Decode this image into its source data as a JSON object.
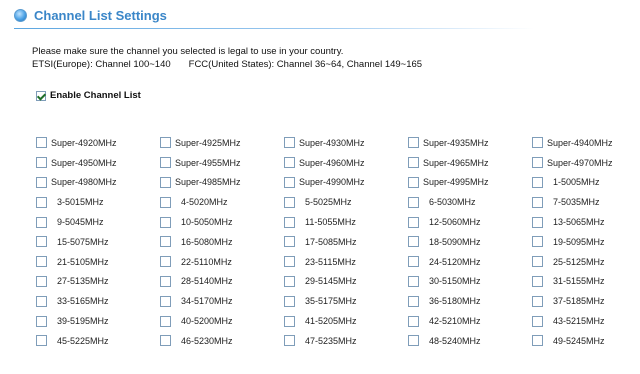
{
  "section": {
    "title": "Channel List Settings"
  },
  "notice": {
    "line1": "Please make sure the channel you selected is legal to use in your country.",
    "etsi": "ETSI(Europe): Channel 100~140",
    "fcc": "FCC(United States): Channel 36~64, Channel 149~165"
  },
  "enable_channel_list": {
    "label": "Enable Channel List",
    "checked": true
  },
  "channels": [
    {
      "label": "Super-4920MHz",
      "checked": false
    },
    {
      "label": "Super-4925MHz",
      "checked": false
    },
    {
      "label": "Super-4930MHz",
      "checked": false
    },
    {
      "label": "Super-4935MHz",
      "checked": false
    },
    {
      "label": "Super-4940MHz",
      "checked": false
    },
    {
      "label": "Super-4950MHz",
      "checked": false
    },
    {
      "label": "Super-4955MHz",
      "checked": false
    },
    {
      "label": "Super-4960MHz",
      "checked": false
    },
    {
      "label": "Super-4965MHz",
      "checked": false
    },
    {
      "label": "Super-4970MHz",
      "checked": false
    },
    {
      "label": "Super-4980MHz",
      "checked": false
    },
    {
      "label": "Super-4985MHz",
      "checked": false
    },
    {
      "label": "Super-4990MHz",
      "checked": false
    },
    {
      "label": "Super-4995MHz",
      "checked": false
    },
    {
      "label": "1-5005MHz",
      "checked": false
    },
    {
      "label": "3-5015MHz",
      "checked": false
    },
    {
      "label": "4-5020MHz",
      "checked": false
    },
    {
      "label": "5-5025MHz",
      "checked": false
    },
    {
      "label": "6-5030MHz",
      "checked": false
    },
    {
      "label": "7-5035MHz",
      "checked": false
    },
    {
      "label": "9-5045MHz",
      "checked": false
    },
    {
      "label": "10-5050MHz",
      "checked": false
    },
    {
      "label": "11-5055MHz",
      "checked": false
    },
    {
      "label": "12-5060MHz",
      "checked": false
    },
    {
      "label": "13-5065MHz",
      "checked": false
    },
    {
      "label": "15-5075MHz",
      "checked": false
    },
    {
      "label": "16-5080MHz",
      "checked": false
    },
    {
      "label": "17-5085MHz",
      "checked": false
    },
    {
      "label": "18-5090MHz",
      "checked": false
    },
    {
      "label": "19-5095MHz",
      "checked": false
    },
    {
      "label": "21-5105MHz",
      "checked": false
    },
    {
      "label": "22-5110MHz",
      "checked": false
    },
    {
      "label": "23-5115MHz",
      "checked": false
    },
    {
      "label": "24-5120MHz",
      "checked": false
    },
    {
      "label": "25-5125MHz",
      "checked": false
    },
    {
      "label": "27-5135MHz",
      "checked": false
    },
    {
      "label": "28-5140MHz",
      "checked": false
    },
    {
      "label": "29-5145MHz",
      "checked": false
    },
    {
      "label": "30-5150MHz",
      "checked": false
    },
    {
      "label": "31-5155MHz",
      "checked": false
    },
    {
      "label": "33-5165MHz",
      "checked": false
    },
    {
      "label": "34-5170MHz",
      "checked": false
    },
    {
      "label": "35-5175MHz",
      "checked": false
    },
    {
      "label": "36-5180MHz",
      "checked": false
    },
    {
      "label": "37-5185MHz",
      "checked": false
    },
    {
      "label": "39-5195MHz",
      "checked": false
    },
    {
      "label": "40-5200MHz",
      "checked": false
    },
    {
      "label": "41-5205MHz",
      "checked": false
    },
    {
      "label": "42-5210MHz",
      "checked": false
    },
    {
      "label": "43-5215MHz",
      "checked": false
    },
    {
      "label": "45-5225MHz",
      "checked": false
    },
    {
      "label": "46-5230MHz",
      "checked": false
    },
    {
      "label": "47-5235MHz",
      "checked": false
    },
    {
      "label": "48-5240MHz",
      "checked": false
    },
    {
      "label": "49-5245MHz",
      "checked": false
    }
  ],
  "colors": {
    "title": "#3a86c8",
    "checkbox_border": "#7f9db9",
    "checkmark": "#1f6f2a"
  },
  "icons": {
    "section": "bullet-dot-icon"
  }
}
